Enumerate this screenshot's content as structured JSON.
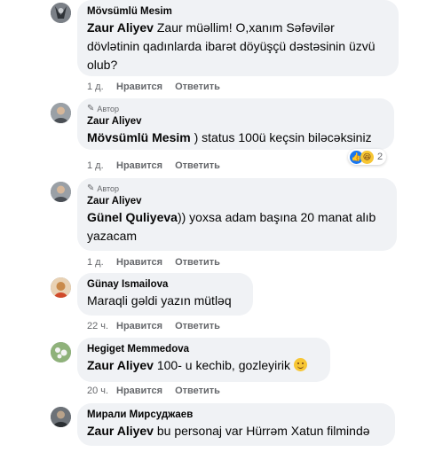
{
  "comments": [
    {
      "author": "Mövsümlü Mesim",
      "author_badge": "",
      "mention": "Zaur Aliyev",
      "text": " Zaur müəllim! O,xanım Səfəvilər dövlətinin qadınlarda ibarət döyüşçü dəstəsinin üzvü olub?",
      "time": "1 д.",
      "like": "Нравится",
      "reply": "Ответить"
    },
    {
      "author": "Zaur Aliyev",
      "author_badge": "Автор",
      "mention": "Mövsümlü Mesim",
      "text": " ) status 100ü keçsin biləcəksiniz",
      "time": "1 д.",
      "like": "Нравится",
      "reply": "Ответить",
      "reactions": {
        "count": "2",
        "types": [
          "like-icon",
          "haha-icon"
        ]
      }
    },
    {
      "author": "Zaur Aliyev",
      "author_badge": "Автор",
      "mention": "Günel Quliyeva",
      "text": ")) yoxsa adam başına 20 manat alıb yazacam",
      "time": "1 д.",
      "like": "Нравится",
      "reply": "Ответить"
    },
    {
      "author": "Günay Ismailova",
      "author_badge": "",
      "mention": "",
      "text": "Maraqli gəldi yazın mütləq",
      "time": "22 ч.",
      "like": "Нравится",
      "reply": "Ответить"
    },
    {
      "author": "Hegiget Memmedova",
      "author_badge": "",
      "mention": "Zaur Aliyev",
      "text": " 100- u kechib, gozleyirik ",
      "time": "20 ч.",
      "like": "Нравится",
      "reply": "Ответить"
    },
    {
      "author": "Мирали Мирсуджаев",
      "author_badge": "",
      "mention": "Zaur Aliyev",
      "text": " bu personaj var Hürrəm Xatun filmində",
      "time": "",
      "like": "",
      "reply": ""
    }
  ],
  "colors": {
    "bubble": "#f0f2f5",
    "meta": "#65676b",
    "like_blue": "#1877f2"
  }
}
